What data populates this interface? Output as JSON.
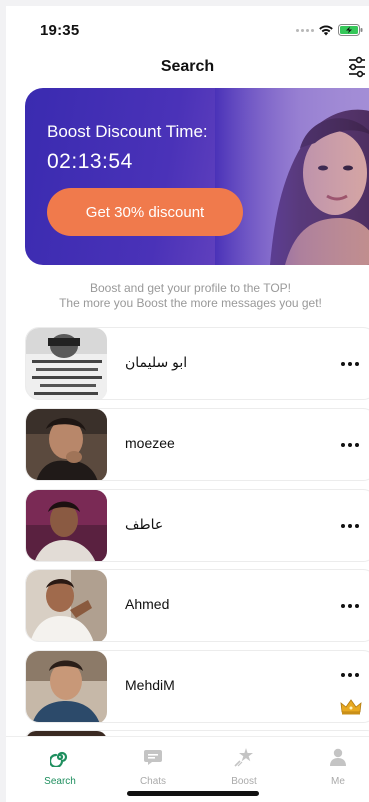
{
  "status_bar": {
    "time": "19:35"
  },
  "nav": {
    "title": "Search"
  },
  "banner": {
    "title": "Boost Discount Time:",
    "timer": "02:13:54",
    "button_label": "Get 30% discount"
  },
  "promo": {
    "line1": "Boost and get your profile to the TOP!",
    "line2": "The more you Boost the more messages you get!"
  },
  "users": [
    {
      "name": "ابو سليمان"
    },
    {
      "name": "moezee"
    },
    {
      "name": "عاطف"
    },
    {
      "name": "Ahmed"
    },
    {
      "name": "MehdiM"
    }
  ],
  "tabs": [
    {
      "label": "Search",
      "icon": "search-swirl-icon"
    },
    {
      "label": "Chats",
      "icon": "chat-bubble-icon"
    },
    {
      "label": "Boost",
      "icon": "boost-star-icon"
    },
    {
      "label": "Me",
      "icon": "person-icon"
    }
  ],
  "colors": {
    "accent": "#1f8f5f",
    "discount_button": "#f07a4c",
    "banner_start": "#3a2bb0",
    "banner_end": "#8e6ccd",
    "crown": "#e8a920"
  }
}
